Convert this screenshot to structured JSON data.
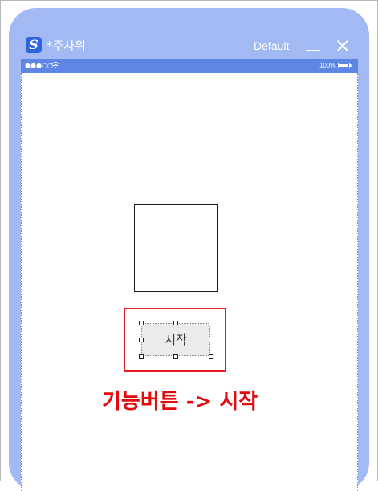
{
  "window": {
    "app_icon_letter": "S",
    "title": "*주사위",
    "preset": "Default",
    "minimize_icon": "minimize-icon",
    "close_icon": "close-icon"
  },
  "statusbar": {
    "signal": "●●●○○",
    "wifi_icon": "wifi-icon",
    "battery_percent": "100%",
    "battery_icon": "battery-icon"
  },
  "canvas": {
    "image_placeholder": "",
    "start_button_label": "시작"
  },
  "annotation": {
    "text": "기능버튼 -> 시작",
    "color": "#e20a0f"
  },
  "colors": {
    "frame": "#a2b9f3",
    "statusbar": "#5d86e5",
    "highlight": "#e51e24"
  }
}
